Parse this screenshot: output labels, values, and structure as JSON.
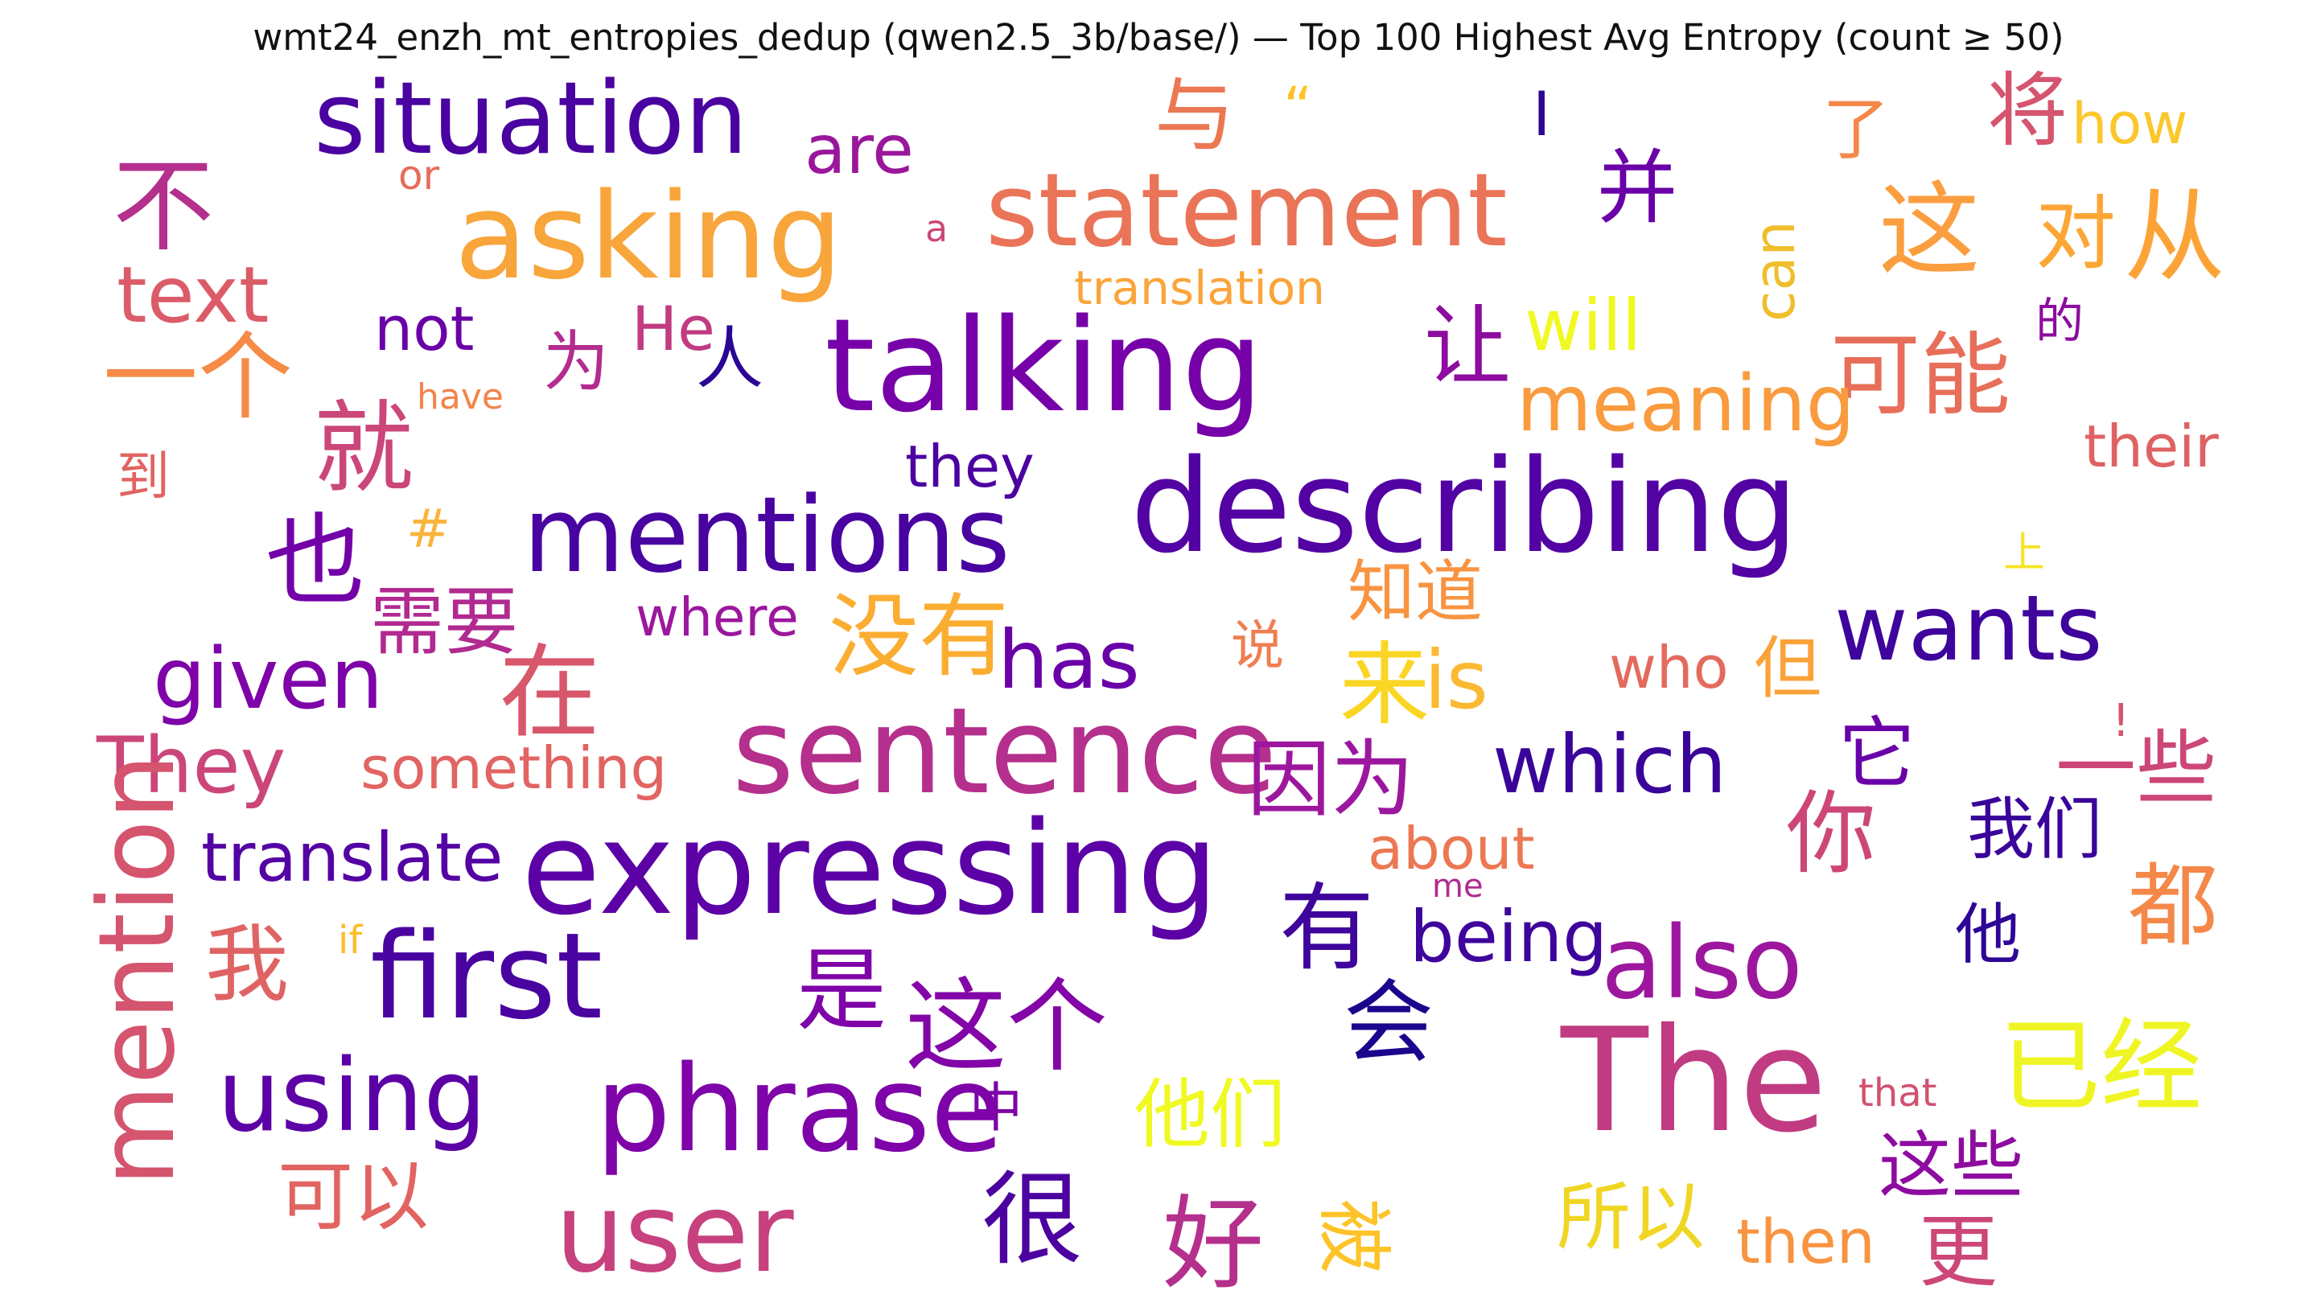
{
  "chart_data": {
    "type": "wordcloud",
    "title": "wmt24_enzh_mt_entropies_dedup (qwen2.5_3b/base/) — Top 100 Highest Avg Entropy (count ≥ 50)",
    "words": [
      {
        "text": "situation",
        "color": "#4a02a0"
      },
      {
        "text": "与",
        "color": "#ec7853"
      },
      {
        "text": "“",
        "color": "#fdc328"
      },
      {
        "text": "I",
        "color": "#2c0594"
      },
      {
        "text": "了",
        "color": "#f48849"
      },
      {
        "text": "将",
        "color": "#d5546e"
      },
      {
        "text": "how",
        "color": "#fbc72a"
      },
      {
        "text": "are",
        "color": "#9a179b"
      },
      {
        "text": "不",
        "color": "#b52f8c"
      },
      {
        "text": "or",
        "color": "#e66c5c"
      },
      {
        "text": "asking",
        "color": "#f8a53b"
      },
      {
        "text": "statement",
        "color": "#ea7457"
      },
      {
        "text": "并",
        "color": "#6a00a8"
      },
      {
        "text": "这",
        "color": "#fb9e3f"
      },
      {
        "text": "对",
        "color": "#fca636"
      },
      {
        "text": "从",
        "color": "#fca338"
      },
      {
        "text": "a",
        "color": "#cc4778"
      },
      {
        "text": "text",
        "color": "#db5c68"
      },
      {
        "text": "translation",
        "color": "#fba43a"
      },
      {
        "text": "can",
        "color": "#f0be2c"
      },
      {
        "text": "一个",
        "color": "#f58b47"
      },
      {
        "text": "not",
        "color": "#6a00a8"
      },
      {
        "text": "为",
        "color": "#b32c8e"
      },
      {
        "text": "He",
        "color": "#c13b82"
      },
      {
        "text": "人",
        "color": "#2b0594"
      },
      {
        "text": "talking",
        "color": "#7701a8"
      },
      {
        "text": "让",
        "color": "#8e0ba0"
      },
      {
        "text": "will",
        "color": "#f0f921"
      },
      {
        "text": "可能",
        "color": "#e76f5a"
      },
      {
        "text": "的",
        "color": "#8e0ba0"
      },
      {
        "text": "have",
        "color": "#f2844b"
      },
      {
        "text": "就",
        "color": "#cb4679"
      },
      {
        "text": "meaning",
        "color": "#f99b3e"
      },
      {
        "text": "到",
        "color": "#e16462"
      },
      {
        "text": "they",
        "color": "#4c02a1"
      },
      {
        "text": "their",
        "color": "#df6263"
      },
      {
        "text": "#",
        "color": "#f9b43d"
      },
      {
        "text": "mentions",
        "color": "#4903a0"
      },
      {
        "text": "describing",
        "color": "#5302a3"
      },
      {
        "text": "也",
        "color": "#7201a8"
      },
      {
        "text": "需要",
        "color": "#b12a90"
      },
      {
        "text": "where",
        "color": "#9c179e"
      },
      {
        "text": "没有",
        "color": "#fbad32"
      },
      {
        "text": "知道",
        "color": "#f89441"
      },
      {
        "text": "上",
        "color": "#f7e425"
      },
      {
        "text": "wants",
        "color": "#3e049c"
      },
      {
        "text": "说",
        "color": "#ef7e50"
      },
      {
        "text": "given",
        "color": "#7e03a8"
      },
      {
        "text": "在",
        "color": "#d8576b"
      },
      {
        "text": "has",
        "color": "#6a00a8"
      },
      {
        "text": "来",
        "color": "#fbd524"
      },
      {
        "text": "is",
        "color": "#fbb933"
      },
      {
        "text": "who",
        "color": "#e36b5d"
      },
      {
        "text": "但",
        "color": "#fba238"
      },
      {
        "text": "!",
        "color": "#d5546e"
      },
      {
        "text": "They",
        "color": "#cb4679"
      },
      {
        "text": "something",
        "color": "#e16462"
      },
      {
        "text": "sentence",
        "color": "#b52f8c"
      },
      {
        "text": "因为",
        "color": "#9c179e"
      },
      {
        "text": "which",
        "color": "#3a049a"
      },
      {
        "text": "它",
        "color": "#6a00a8"
      },
      {
        "text": "一些",
        "color": "#cc4778"
      },
      {
        "text": "你",
        "color": "#cc4778"
      },
      {
        "text": "我们",
        "color": "#3a049a"
      },
      {
        "text": "mention",
        "color": "#d5546e"
      },
      {
        "text": "translate",
        "color": "#5402a3"
      },
      {
        "text": "expressing",
        "color": "#5c01a6"
      },
      {
        "text": "about",
        "color": "#ec7853"
      },
      {
        "text": "me",
        "color": "#b12a90"
      },
      {
        "text": "有",
        "color": "#3e049c"
      },
      {
        "text": "都",
        "color": "#f48849"
      },
      {
        "text": "我",
        "color": "#e06363"
      },
      {
        "text": "if",
        "color": "#fbbe2a"
      },
      {
        "text": "first",
        "color": "#4903a0"
      },
      {
        "text": "being",
        "color": "#3e049c"
      },
      {
        "text": "also",
        "color": "#9c179e"
      },
      {
        "text": "他",
        "color": "#2e0595"
      },
      {
        "text": "是",
        "color": "#7e03a8"
      },
      {
        "text": "这个",
        "color": "#8305a7"
      },
      {
        "text": "会",
        "color": "#1a068d"
      },
      {
        "text": "The",
        "color": "#c13b82"
      },
      {
        "text": "已经",
        "color": "#eff524"
      },
      {
        "text": "using",
        "color": "#5c01a6"
      },
      {
        "text": "phrase",
        "color": "#7e03a8"
      },
      {
        "text": "中",
        "color": "#7e03a8"
      },
      {
        "text": "他们",
        "color": "#f0f921"
      },
      {
        "text": "被",
        "color": "#fdc328"
      },
      {
        "text": "that",
        "color": "#d35171"
      },
      {
        "text": "这些",
        "color": "#8e0ba0"
      },
      {
        "text": "可以",
        "color": "#e16462"
      },
      {
        "text": "user",
        "color": "#c6417d"
      },
      {
        "text": "很",
        "color": "#4c02a1"
      },
      {
        "text": "好",
        "color": "#b52f8c"
      },
      {
        "text": "所以",
        "color": "#f0d624"
      },
      {
        "text": "then",
        "color": "#f89441"
      },
      {
        "text": "更",
        "color": "#cc4778"
      }
    ]
  }
}
